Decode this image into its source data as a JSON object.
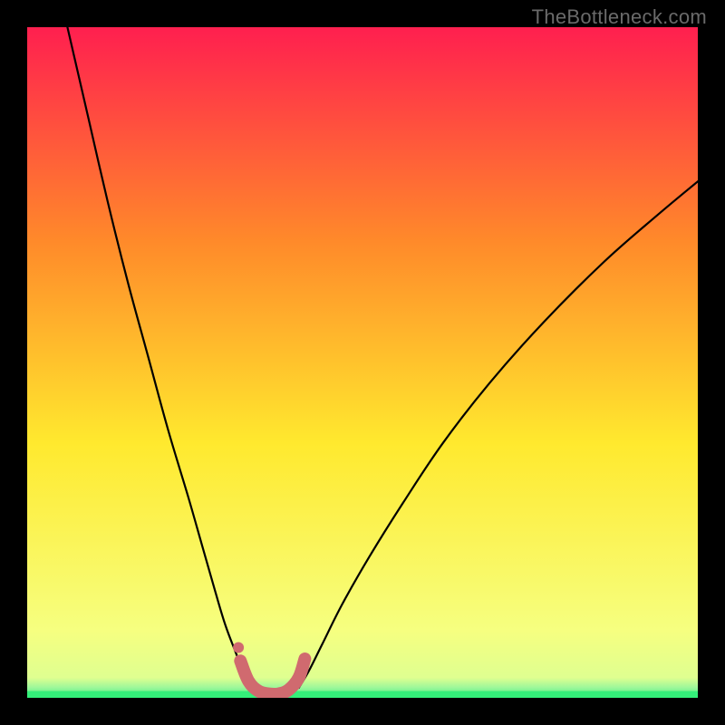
{
  "watermark": "TheBottleneck.com",
  "chart_data": {
    "type": "line",
    "title": "",
    "xlabel": "",
    "ylabel": "",
    "xlim": [
      0,
      1
    ],
    "ylim": [
      0,
      1
    ],
    "grid": false,
    "legend": false,
    "background_gradient": {
      "top": "#ff1f4f",
      "upper_mid": "#ff8a2a",
      "mid": "#ffe92e",
      "lower": "#f6ff80",
      "min_band": "#34f07a"
    },
    "series": [
      {
        "name": "left-curve",
        "stroke": "#000000",
        "x": [
          0.06,
          0.09,
          0.12,
          0.15,
          0.18,
          0.21,
          0.24,
          0.26,
          0.28,
          0.295,
          0.31,
          0.322,
          0.333
        ],
        "y": [
          1.0,
          0.87,
          0.74,
          0.62,
          0.51,
          0.4,
          0.3,
          0.23,
          0.16,
          0.11,
          0.07,
          0.04,
          0.015
        ]
      },
      {
        "name": "right-curve",
        "stroke": "#000000",
        "x": [
          0.405,
          0.42,
          0.44,
          0.47,
          0.51,
          0.56,
          0.62,
          0.69,
          0.77,
          0.86,
          0.94,
          1.0
        ],
        "y": [
          0.015,
          0.04,
          0.08,
          0.14,
          0.21,
          0.29,
          0.38,
          0.47,
          0.56,
          0.65,
          0.72,
          0.77
        ]
      },
      {
        "name": "valley-marker",
        "stroke": "#d06a6f",
        "x": [
          0.318,
          0.33,
          0.345,
          0.36,
          0.375,
          0.39,
          0.405,
          0.414
        ],
        "y": [
          0.055,
          0.025,
          0.01,
          0.006,
          0.006,
          0.012,
          0.03,
          0.058
        ]
      }
    ],
    "valley_dot": {
      "x": 0.315,
      "y": 0.075
    },
    "green_band": {
      "y_from": 0.0,
      "y_to": 0.01
    }
  }
}
